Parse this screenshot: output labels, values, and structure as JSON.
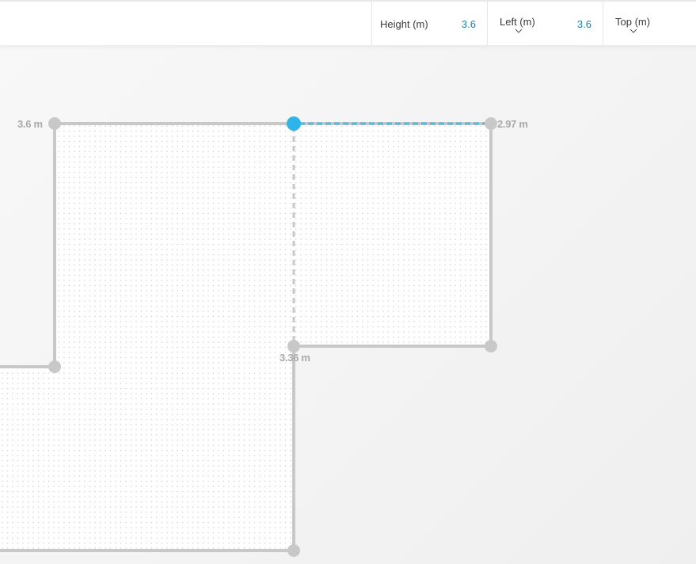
{
  "toolbar": {
    "height": {
      "label": "Height (m)",
      "value": "3.6"
    },
    "left": {
      "label": "Left (m)",
      "value": "3.6"
    },
    "top": {
      "label": "Top (m)"
    }
  },
  "icons": {
    "left_dropdown": "chevron-down-icon",
    "top_dropdown": "chevron-down-icon"
  },
  "plan": {
    "dimension_labels": {
      "left_wall": "3.6 m",
      "top_right_wall": "2.97 m",
      "inner_wall": "3.36 m"
    }
  },
  "colors": {
    "wall": "#c8c8c8",
    "selected_node": "#2eb4e8",
    "selected_edge": "#5bb7d8",
    "accent_value": "#1f7fa6",
    "floor_dots": "#d0d0d0"
  }
}
